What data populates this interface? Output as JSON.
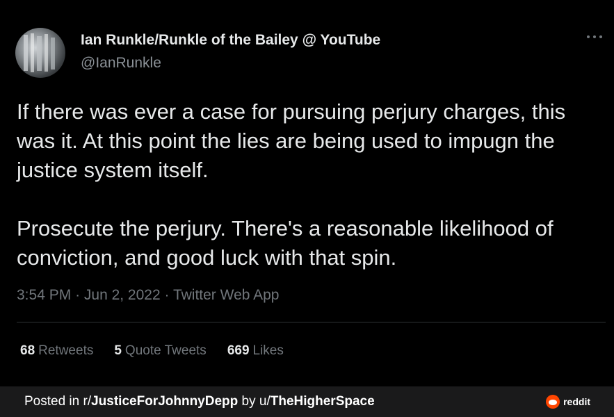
{
  "tweet": {
    "display_name": "Ian Runkle/Runkle of the Bailey @ YouTube",
    "handle": "@IanRunkle",
    "paragraphs": [
      "If there was ever a case for pursuing perjury charges, this was it. At this point the lies are being used to impugn the justice system itself.",
      "Prosecute the perjury. There's a reasonable likelihood of conviction, and good luck with that spin."
    ],
    "time": "3:54 PM",
    "date": "Jun 2, 2022",
    "source": "Twitter Web App",
    "separator": "·",
    "stats": {
      "retweets_count": "68",
      "retweets_label": "Retweets",
      "quotes_count": "5",
      "quotes_label": "Quote Tweets",
      "likes_count": "669",
      "likes_label": "Likes"
    }
  },
  "footer": {
    "prefix": "Posted in r/",
    "subreddit": "JusticeForJohnnyDepp",
    "by": " by u/",
    "user": "TheHigherSpace",
    "brand": "reddit"
  },
  "colors": {
    "background": "#000000",
    "text": "#e7e9ea",
    "muted": "#71767b",
    "footer_bg": "#1a1a1b",
    "reddit_orange": "#ff4500"
  },
  "icons": {
    "more": "more-dots-icon",
    "reddit": "reddit-logo-icon"
  }
}
